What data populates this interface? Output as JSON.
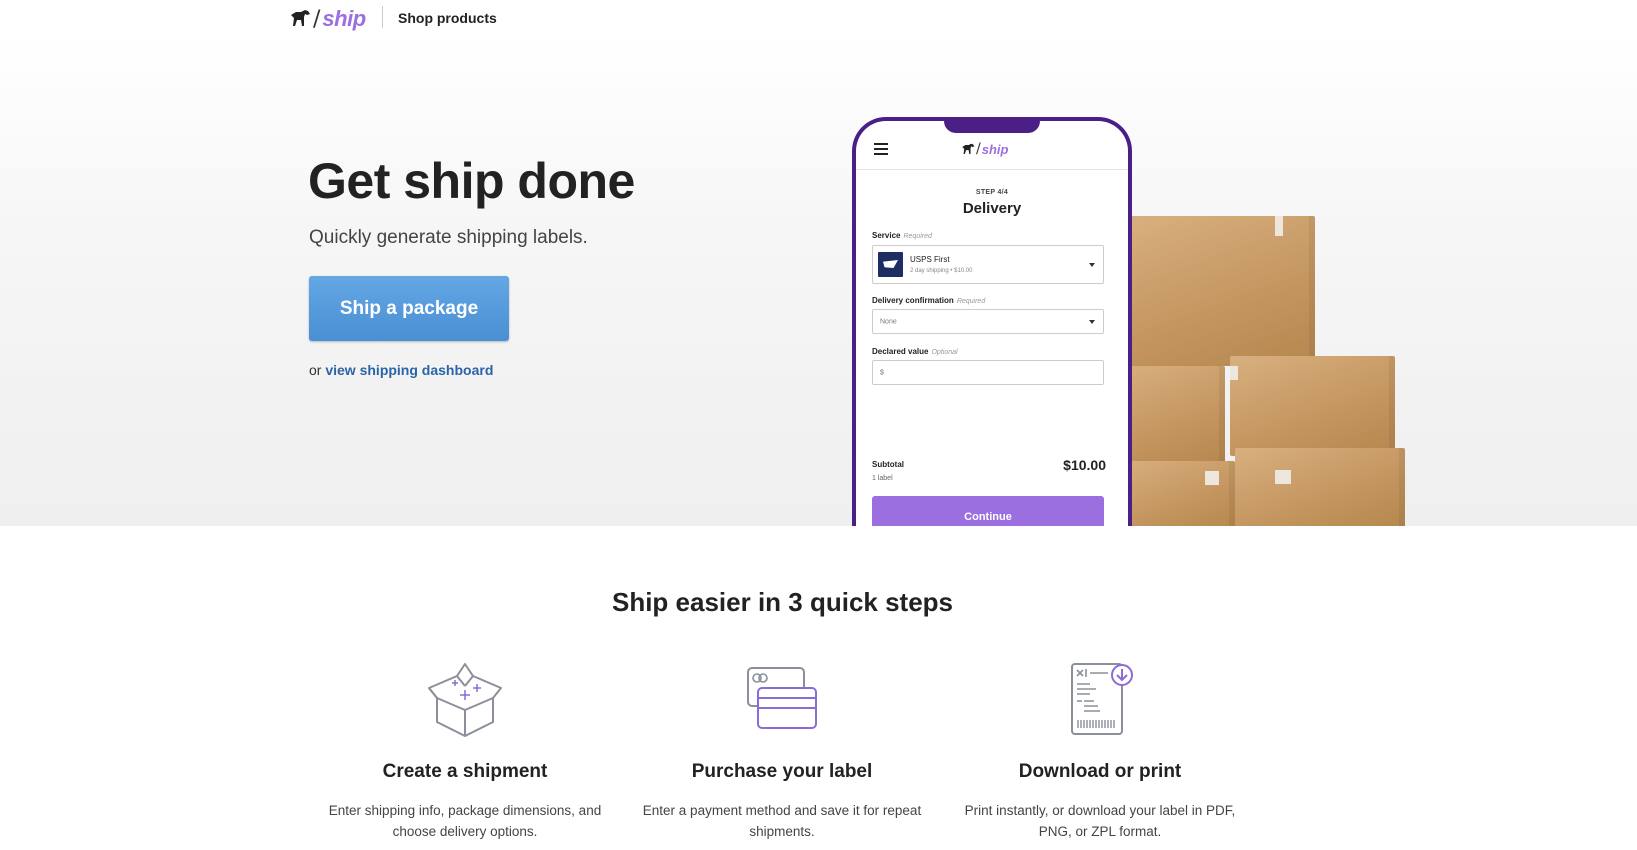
{
  "header": {
    "brand_word": "ship",
    "nav_link": "Shop products"
  },
  "hero": {
    "title": "Get ship done",
    "subtitle": "Quickly generate shipping labels.",
    "cta_label": "Ship a package",
    "or_text": "or",
    "dashboard_link": "view shipping dashboard"
  },
  "phone": {
    "brand_word": "ship",
    "step": "STEP 4/4",
    "title": "Delivery",
    "service_label": "Service",
    "service_required": "Required",
    "service_name": "USPS First",
    "service_desc": "2 day shipping • $10.00",
    "confirmation_label": "Delivery confirmation",
    "confirmation_required": "Required",
    "confirmation_value": "None",
    "declared_label": "Declared value",
    "declared_optional": "Optional",
    "declared_placeholder": "$",
    "subtotal_label": "Subtotal",
    "subtotal_count": "1 label",
    "subtotal_amount": "$10.00",
    "continue_label": "Continue"
  },
  "steps": {
    "title": "Ship easier in 3 quick steps",
    "items": [
      {
        "icon": "open-box-icon",
        "title": "Create a shipment",
        "desc": "Enter shipping info, package dimensions, and choose delivery options."
      },
      {
        "icon": "credit-card-icon",
        "title": "Purchase your label",
        "desc": "Enter a payment method and save it for repeat shipments."
      },
      {
        "icon": "label-download-icon",
        "title": "Download or print",
        "desc": "Print instantly, or download your label in PDF, PNG, or ZPL format."
      }
    ]
  },
  "colors": {
    "brand_purple": "#9b6fe0",
    "phone_frame": "#4b1f86",
    "cta_blue": "#4a8fd3",
    "link_blue": "#2a64a8",
    "icon_purple": "#8b6bd8",
    "icon_gray": "#8a8f99"
  }
}
